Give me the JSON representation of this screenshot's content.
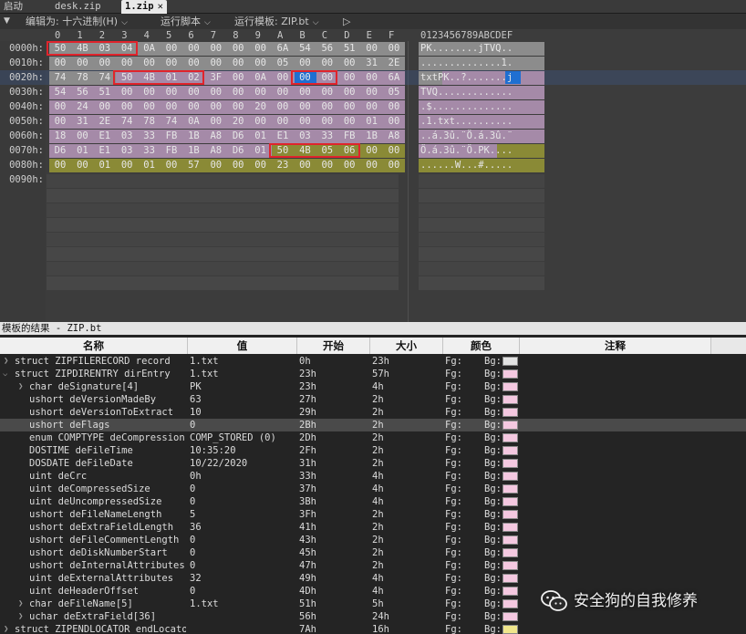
{
  "tabs": [
    {
      "label": "启动",
      "active": false
    },
    {
      "label": "desk.zip",
      "active": false
    },
    {
      "label": "1.zip",
      "active": true
    }
  ],
  "toolbar": {
    "edit_as": "编辑为: 十六进制(H)",
    "run_script": "运行脚本",
    "run_template": "运行模板: ZIP.bt",
    "play_icon": "play-icon"
  },
  "hex": {
    "column_labels": [
      "0",
      "1",
      "2",
      "3",
      "4",
      "5",
      "6",
      "7",
      "8",
      "9",
      "A",
      "B",
      "C",
      "D",
      "E",
      "F"
    ],
    "ascii_header": "0123456789ABCDEF",
    "rows": [
      {
        "offset": "0000h:",
        "bytes": [
          "50",
          "4B",
          "03",
          "04",
          "0A",
          "00",
          "00",
          "00",
          "00",
          "00",
          "6A",
          "54",
          "56",
          "51",
          "00",
          "00"
        ],
        "ascii": "PK........jTVQ.."
      },
      {
        "offset": "0010h:",
        "bytes": [
          "00",
          "00",
          "00",
          "00",
          "00",
          "00",
          "00",
          "00",
          "00",
          "00",
          "05",
          "00",
          "00",
          "00",
          "31",
          "2E"
        ],
        "ascii": "..............1."
      },
      {
        "offset": "0020h:",
        "bytes": [
          "74",
          "78",
          "74",
          "50",
          "4B",
          "01",
          "02",
          "3F",
          "00",
          "0A",
          "00",
          "00",
          "00",
          "00",
          "00",
          "6A"
        ],
        "ascii": "txtPK..?.......j"
      },
      {
        "offset": "0030h:",
        "bytes": [
          "54",
          "56",
          "51",
          "00",
          "00",
          "00",
          "00",
          "00",
          "00",
          "00",
          "00",
          "00",
          "00",
          "00",
          "00",
          "05"
        ],
        "ascii": "TVQ............."
      },
      {
        "offset": "0040h:",
        "bytes": [
          "00",
          "24",
          "00",
          "00",
          "00",
          "00",
          "00",
          "00",
          "00",
          "20",
          "00",
          "00",
          "00",
          "00",
          "00",
          "00"
        ],
        "ascii": ".$.............."
      },
      {
        "offset": "0050h:",
        "bytes": [
          "00",
          "31",
          "2E",
          "74",
          "78",
          "74",
          "0A",
          "00",
          "20",
          "00",
          "00",
          "00",
          "00",
          "00",
          "01",
          "00"
        ],
        "ascii": ".1.txt.........."
      },
      {
        "offset": "0060h:",
        "bytes": [
          "18",
          "00",
          "E1",
          "03",
          "33",
          "FB",
          "1B",
          "A8",
          "D6",
          "01",
          "E1",
          "03",
          "33",
          "FB",
          "1B",
          "A8"
        ],
        "ascii": "..á.3û.¨Ö.á.3û.¨"
      },
      {
        "offset": "0070h:",
        "bytes": [
          "D6",
          "01",
          "E1",
          "03",
          "33",
          "FB",
          "1B",
          "A8",
          "D6",
          "01",
          "50",
          "4B",
          "05",
          "06",
          "00",
          "00"
        ],
        "ascii": "Ö.á.3û.¨Ö.PK...."
      },
      {
        "offset": "0080h:",
        "bytes": [
          "00",
          "00",
          "01",
          "00",
          "01",
          "00",
          "57",
          "00",
          "00",
          "00",
          "23",
          "00",
          "00",
          "00",
          "00",
          "00"
        ],
        "ascii": "......W...#....."
      },
      {
        "offset": "0090h:",
        "bytes": [],
        "ascii": ""
      }
    ]
  },
  "results": {
    "title": "模板的结果 - ZIP.bt",
    "headers": {
      "name": "名称",
      "value": "值",
      "start": "开始",
      "size": "大小",
      "color": "颜色",
      "comment": "注释"
    },
    "fg_label": "Fg:",
    "bg_label": "Bg:",
    "rows": [
      {
        "name": "struct ZIPFILERECORD record",
        "value": "1.txt",
        "start": "0h",
        "size": "23h",
        "bg": "#e2e2e2",
        "indent": 0,
        "expander": "right"
      },
      {
        "name": "struct ZIPDIRENTRY dirEntry",
        "value": "1.txt",
        "start": "23h",
        "size": "57h",
        "bg": "#f4c8e0",
        "indent": 0,
        "expander": "down"
      },
      {
        "name": "char deSignature[4]",
        "value": "PK",
        "start": "23h",
        "size": "4h",
        "bg": "#f4c8e0",
        "indent": 1,
        "expander": "right"
      },
      {
        "name": "ushort deVersionMadeBy",
        "value": "63",
        "start": "27h",
        "size": "2h",
        "bg": "#f4c8e0",
        "indent": 1,
        "expander": ""
      },
      {
        "name": "ushort deVersionToExtract",
        "value": "10",
        "start": "29h",
        "size": "2h",
        "bg": "#f4c8e0",
        "indent": 1,
        "expander": ""
      },
      {
        "name": "ushort deFlags",
        "value": "0",
        "start": "2Bh",
        "size": "2h",
        "bg": "#f4c8e0",
        "indent": 1,
        "expander": "",
        "selected": true
      },
      {
        "name": "enum COMPTYPE deCompression",
        "value": "COMP_STORED (0)",
        "start": "2Dh",
        "size": "2h",
        "bg": "#f4c8e0",
        "indent": 1,
        "expander": ""
      },
      {
        "name": "DOSTIME deFileTime",
        "value": "10:35:20",
        "start": "2Fh",
        "size": "2h",
        "bg": "#f4c8e0",
        "indent": 1,
        "expander": ""
      },
      {
        "name": "DOSDATE deFileDate",
        "value": "10/22/2020",
        "start": "31h",
        "size": "2h",
        "bg": "#f4c8e0",
        "indent": 1,
        "expander": ""
      },
      {
        "name": "uint deCrc",
        "value": "0h",
        "start": "33h",
        "size": "4h",
        "bg": "#f4c8e0",
        "indent": 1,
        "expander": ""
      },
      {
        "name": "uint deCompressedSize",
        "value": "0",
        "start": "37h",
        "size": "4h",
        "bg": "#f4c8e0",
        "indent": 1,
        "expander": ""
      },
      {
        "name": "uint deUncompressedSize",
        "value": "0",
        "start": "3Bh",
        "size": "4h",
        "bg": "#f4c8e0",
        "indent": 1,
        "expander": ""
      },
      {
        "name": "ushort deFileNameLength",
        "value": "5",
        "start": "3Fh",
        "size": "2h",
        "bg": "#f4c8e0",
        "indent": 1,
        "expander": ""
      },
      {
        "name": "ushort deExtraFieldLength",
        "value": "36",
        "start": "41h",
        "size": "2h",
        "bg": "#f4c8e0",
        "indent": 1,
        "expander": ""
      },
      {
        "name": "ushort deFileCommentLength",
        "value": "0",
        "start": "43h",
        "size": "2h",
        "bg": "#f4c8e0",
        "indent": 1,
        "expander": ""
      },
      {
        "name": "ushort deDiskNumberStart",
        "value": "0",
        "start": "45h",
        "size": "2h",
        "bg": "#f4c8e0",
        "indent": 1,
        "expander": ""
      },
      {
        "name": "ushort deInternalAttributes",
        "value": "0",
        "start": "47h",
        "size": "2h",
        "bg": "#f4c8e0",
        "indent": 1,
        "expander": ""
      },
      {
        "name": "uint deExternalAttributes",
        "value": "32",
        "start": "49h",
        "size": "4h",
        "bg": "#f4c8e0",
        "indent": 1,
        "expander": ""
      },
      {
        "name": "uint deHeaderOffset",
        "value": "0",
        "start": "4Dh",
        "size": "4h",
        "bg": "#f4c8e0",
        "indent": 1,
        "expander": ""
      },
      {
        "name": "char deFileName[5]",
        "value": "1.txt",
        "start": "51h",
        "size": "5h",
        "bg": "#f4c8e0",
        "indent": 1,
        "expander": "right"
      },
      {
        "name": "uchar deExtraField[36]",
        "value": "",
        "start": "56h",
        "size": "24h",
        "bg": "#f4c8e0",
        "indent": 1,
        "expander": "right"
      },
      {
        "name": "struct ZIPENDLOCATOR endLocator",
        "value": "",
        "start": "7Ah",
        "size": "16h",
        "bg": "#f0e68c",
        "indent": 0,
        "expander": "right"
      }
    ]
  },
  "watermark": {
    "text": "安全狗的自我修养",
    "icon": "wechat-icon"
  },
  "colors": {
    "record_bg": "#8c8c8c",
    "direntry_bg": "#a58aa8",
    "endlocator_bg": "#8a8a36",
    "selection": "#1f6fd1",
    "highlight_box": "#e0242c"
  }
}
